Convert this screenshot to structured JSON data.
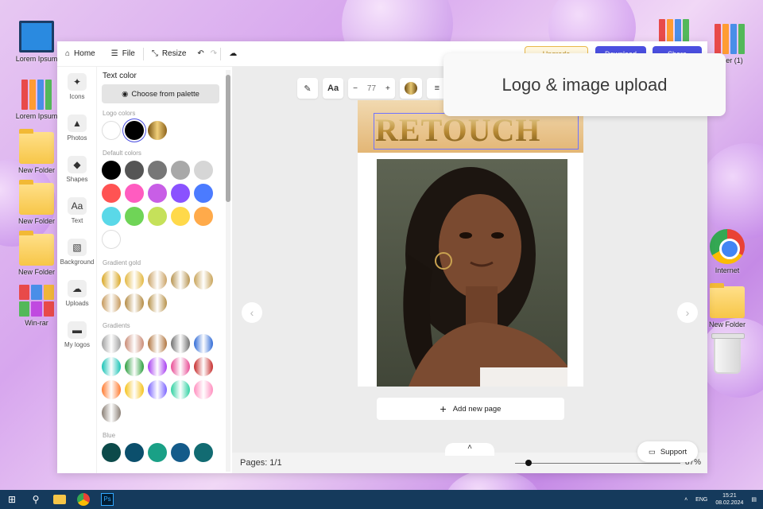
{
  "desktop": {
    "icons_left": [
      {
        "label": "Lorem Ipsum",
        "type": "computer"
      },
      {
        "label": "Lorem Ipsum",
        "type": "books"
      },
      {
        "label": "New Folder",
        "type": "folder"
      },
      {
        "label": "New Folder",
        "type": "folder"
      },
      {
        "label": "New Folder",
        "type": "folder"
      },
      {
        "label": "Win-rar",
        "type": "winrar"
      }
    ],
    "icons_right": [
      {
        "label": "older (1)",
        "type": "books"
      },
      {
        "label": "Internet",
        "type": "chrome"
      },
      {
        "label": "New Folder",
        "type": "folder"
      },
      {
        "label": "",
        "type": "trash"
      }
    ]
  },
  "topbar": {
    "home": "Home",
    "file": "File",
    "resize": "Resize",
    "upgrade": "Upgrade",
    "download": "Download",
    "share": "Share"
  },
  "rail": [
    {
      "label": "Icons",
      "icon": "sparkle-icon",
      "glyph": "✦"
    },
    {
      "label": "Photos",
      "icon": "image-icon",
      "glyph": "▲"
    },
    {
      "label": "Shapes",
      "icon": "shapes-icon",
      "glyph": "◆"
    },
    {
      "label": "Text",
      "icon": "text-icon",
      "glyph": "Aa"
    },
    {
      "label": "Background",
      "icon": "background-icon",
      "glyph": "▧"
    },
    {
      "label": "Uploads",
      "icon": "upload-icon",
      "glyph": "☁"
    },
    {
      "label": "My logos",
      "icon": "folder-icon",
      "glyph": "▬"
    }
  ],
  "panel": {
    "title": "Text color",
    "palette_button": "Choose from palette",
    "sections": {
      "logo": "Logo colors",
      "default": "Default colors",
      "gradient_gold": "Gradient gold",
      "gradients": "Gradients",
      "blue": "Blue"
    },
    "logo_colors": [
      "#ffffff",
      "#000000",
      "gold"
    ],
    "default_colors": [
      "#000000",
      "#555555",
      "#777777",
      "#a8a8a8",
      "#d6d6d6",
      "#ff5353",
      "#ff5cc0",
      "#c85ee6",
      "#8a52ff",
      "#4b7bff",
      "#5ad8e8",
      "#6fd457",
      "#c5e15a",
      "#ffd94a",
      "#ffaa4a",
      "#ffffff"
    ],
    "gold_gradients": [
      "#d9a621",
      "#e3b73f",
      "#caa265",
      "#b79450",
      "#c8a45a",
      "#c59758",
      "#b38a42",
      "#b69047"
    ],
    "gradients": [
      "#a0a0a0",
      "#c98a74",
      "#b0743d",
      "#707070",
      "#2f6ad6",
      "#18c2b5",
      "#2b9e3e",
      "#a63bf0",
      "#e84b94",
      "#c62b2b",
      "#ff7a2f",
      "#f5c21b",
      "#7a63ff",
      "#2ed1a1",
      "#ff8fbf",
      "#8a7f75"
    ],
    "blue_colors": [
      "#0c4a4a",
      "#0b4f6c",
      "#1aa086",
      "#145b8a",
      "#126b72"
    ]
  },
  "canvas": {
    "zoom_value": "77",
    "logo_text": "RETOUCH",
    "add_page": "Add new page",
    "pages": "Pages: 1/1",
    "zoom_percent": "87%",
    "zoom_level": 0.08,
    "support": "Support"
  },
  "callout": {
    "text": "Logo & image upload"
  },
  "taskbar": {
    "lang": "ENG",
    "time": "15:21",
    "date": "08.02.2024"
  }
}
